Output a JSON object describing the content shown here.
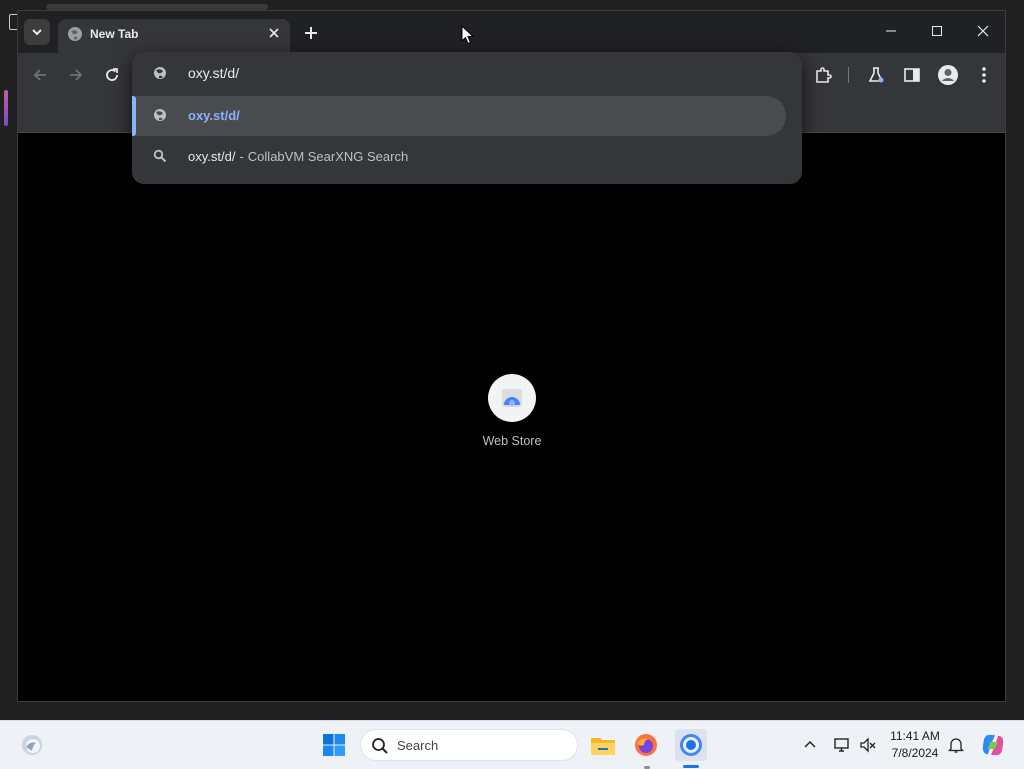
{
  "browser": {
    "tab": {
      "title": "New Tab"
    },
    "omnibox": {
      "input_value": "oxy.st/d/",
      "suggestions": [
        {
          "text": "oxy.st/d/",
          "icon": "globe-icon"
        },
        {
          "text": "oxy.st/d/",
          "separator": "-",
          "description": "CollabVM SearXNG Search",
          "icon": "search-icon"
        }
      ]
    },
    "toolbar_icons": [
      "back-icon",
      "forward-icon",
      "reload-icon",
      "extensions-icon",
      "labs-icon",
      "side-panel-icon",
      "profile-icon",
      "more-menu-icon"
    ],
    "shortcuts": [
      {
        "label": "Web Store"
      }
    ]
  },
  "taskbar": {
    "search_placeholder": "Search",
    "time": "11:41 AM",
    "date": "7/8/2024",
    "apps": [
      "file-explorer-icon",
      "firefox-icon",
      "chrome-icon"
    ]
  },
  "colors": {
    "accent": "#8ab4f8",
    "toolbar": "#35363a",
    "tabstrip": "#202124",
    "taskbar": "#eef1f6"
  }
}
